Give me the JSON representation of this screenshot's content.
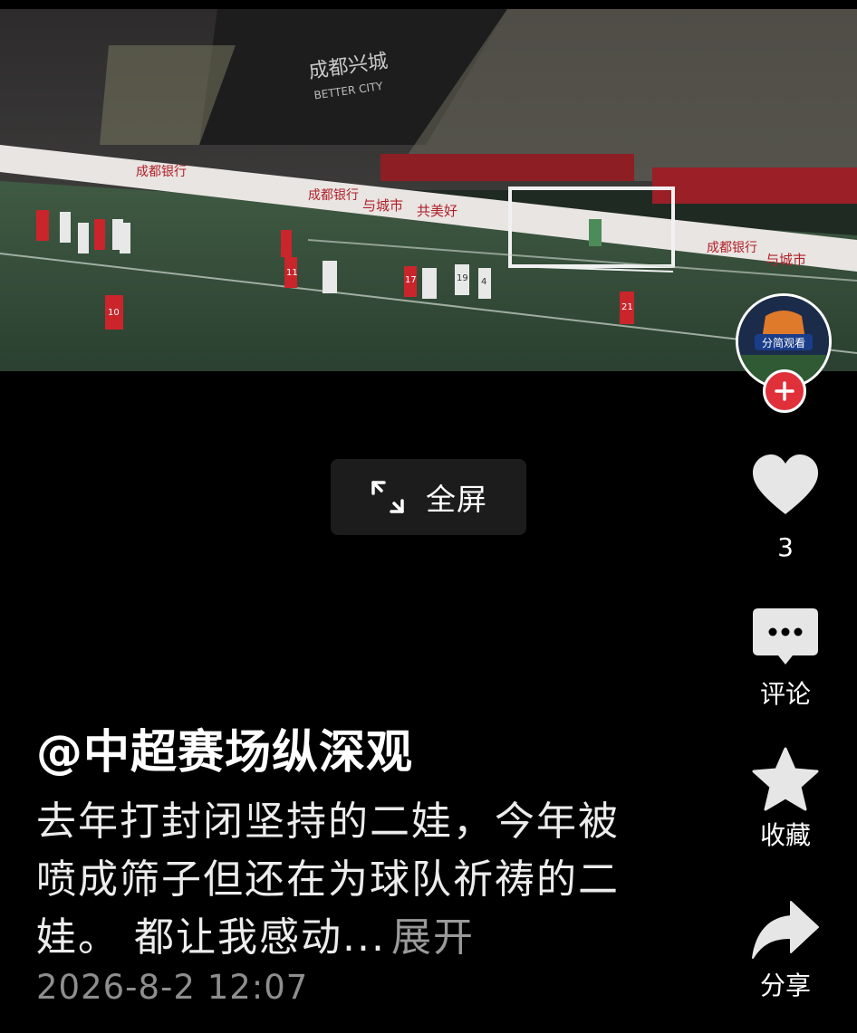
{
  "video": {
    "scene": "football-stadium-penalty-kick",
    "ads": [
      "成都银行",
      "与城市",
      "共美好",
      "成都兴城"
    ],
    "banner_sub": "BETTER CITY",
    "player_numbers": [
      "10",
      "11",
      "19",
      "17",
      "21",
      "4"
    ]
  },
  "fullscreen": {
    "label": "全屏",
    "icon": "expand-arrows-icon"
  },
  "account": {
    "avatar_text": "分简观看",
    "follow_icon": "plus-icon"
  },
  "actions": {
    "like": {
      "icon": "heart-icon",
      "count": "3"
    },
    "comment": {
      "icon": "speech-bubble-icon",
      "label": "评论"
    },
    "favorite": {
      "icon": "star-icon",
      "label": "收藏"
    },
    "share": {
      "icon": "share-arrow-icon",
      "label": "分享"
    }
  },
  "post": {
    "author": "@中超赛场纵深观",
    "caption": "去年打封闭坚持的二娃，今年被喷成筛子但还在为球队祈祷的二娃。 都让我感动...",
    "expand_label": "展开",
    "date": "2026-8-2 12:07"
  },
  "colors": {
    "background": "#000000",
    "follow_button": "#e0303a",
    "muted_text": "#8e8e8e"
  }
}
